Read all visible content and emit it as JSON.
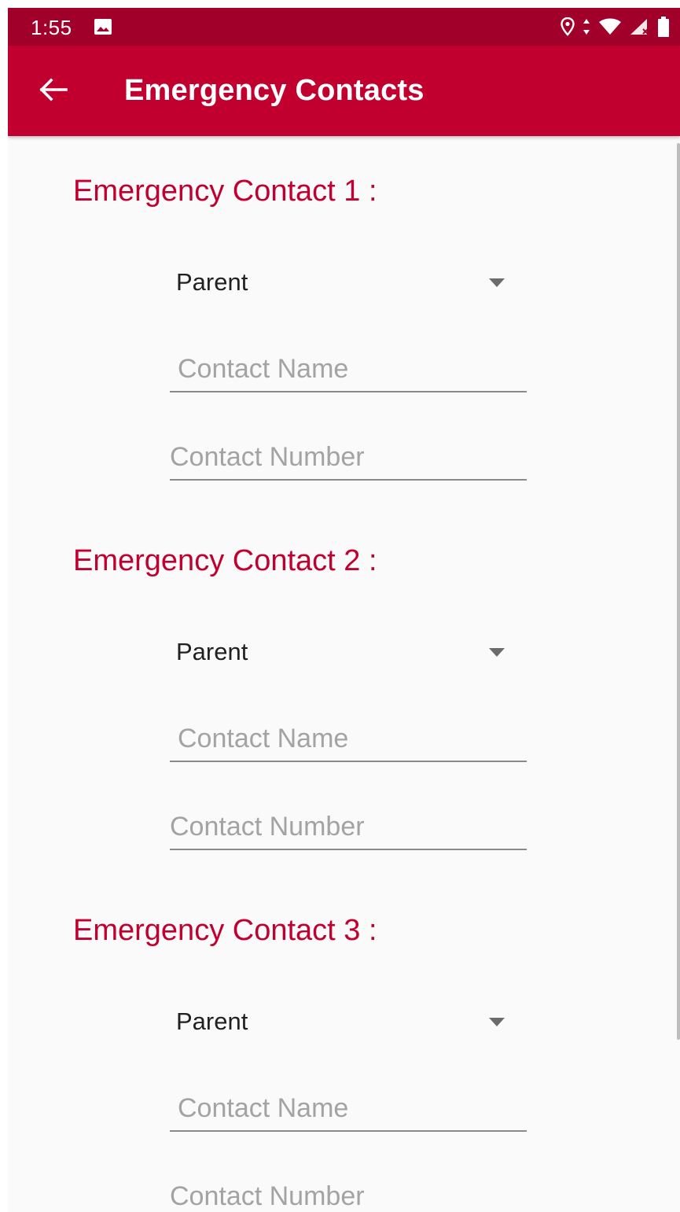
{
  "status_bar": {
    "time": "1:55",
    "icons": [
      "gallery-icon",
      "location-icon",
      "data-arrows-icon",
      "wifi-icon",
      "signal-icon",
      "battery-icon"
    ]
  },
  "app_bar": {
    "title": "Emergency Contacts",
    "back_icon": "arrow-back-icon"
  },
  "colors": {
    "status_bar": "#a1002b",
    "app_bar": "#c2002f",
    "accent": "#c2002f",
    "background": "#fafafa"
  },
  "contacts": [
    {
      "heading": "Emergency Contact 1 :",
      "relation": "Parent",
      "name_placeholder": "Contact Name",
      "number_placeholder": "Contact Number"
    },
    {
      "heading": "Emergency Contact 2 :",
      "relation": "Parent",
      "name_placeholder": "Contact Name",
      "number_placeholder": "Contact Number"
    },
    {
      "heading": "Emergency Contact 3 :",
      "relation": "Parent",
      "name_placeholder": "Contact Name",
      "number_placeholder": "Contact Number"
    }
  ]
}
